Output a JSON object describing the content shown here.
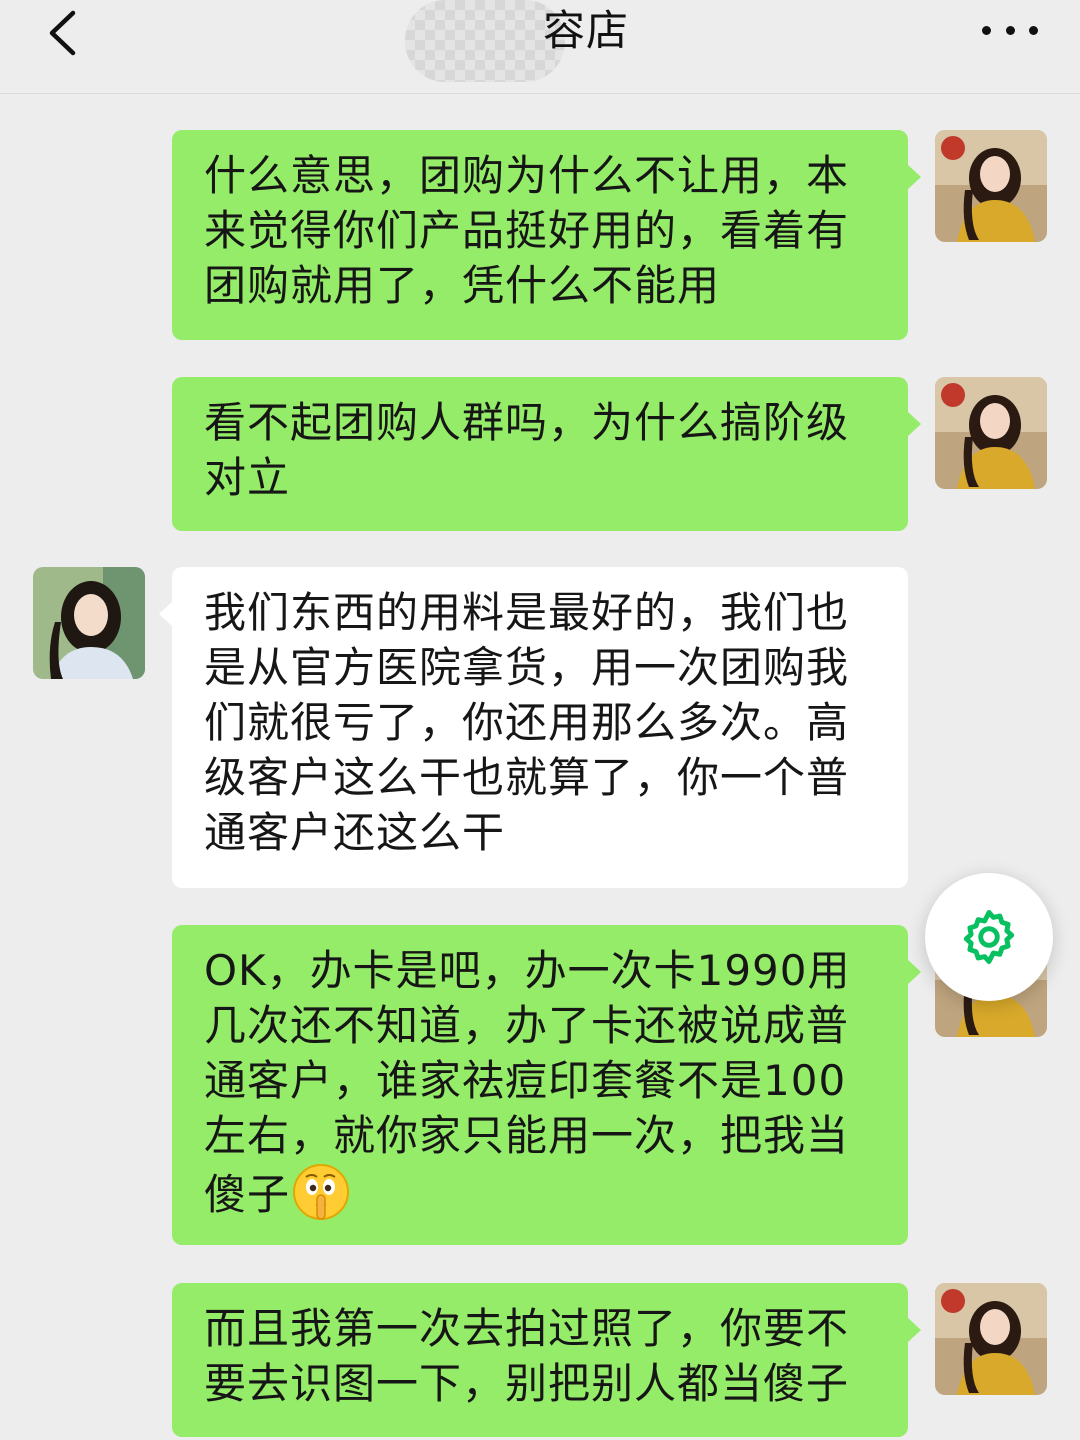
{
  "header": {
    "title": "容店",
    "back_icon": "chevron-left-icon",
    "more_icon": "more-dots-icon"
  },
  "messages": [
    {
      "side": "out",
      "text": "什么意思，团购为什么不让用，本来觉得你们产品挺好用的，看着有团购就用了，凭什么不能用"
    },
    {
      "side": "out",
      "text": "看不起团购人群吗，为什么搞阶级对立"
    },
    {
      "side": "in",
      "text": "我们东西的用料是最好的，我们也是从官方医院拿货，用一次团购我们就很亏了，你还用那么多次。高级客户这么干也就算了，你一个普通客户还这么干"
    },
    {
      "side": "out",
      "text": "OK，办卡是吧，办一次卡1990用几次还不知道，办了卡还被说成普通客户，谁家祛痘印套餐不是100左右，就你家只能用一次，把我当傻子",
      "emoji": "shushing-face-emoji"
    },
    {
      "side": "out",
      "text": "而且我第一次去拍过照了，你要不要去识图一下，别把别人都当傻子"
    }
  ],
  "floating_button": {
    "icon": "gear-icon"
  },
  "colors": {
    "background": "#EDEDED",
    "outgoing_bubble": "#95EC69",
    "incoming_bubble": "#FFFFFF",
    "accent": "#07C160"
  }
}
